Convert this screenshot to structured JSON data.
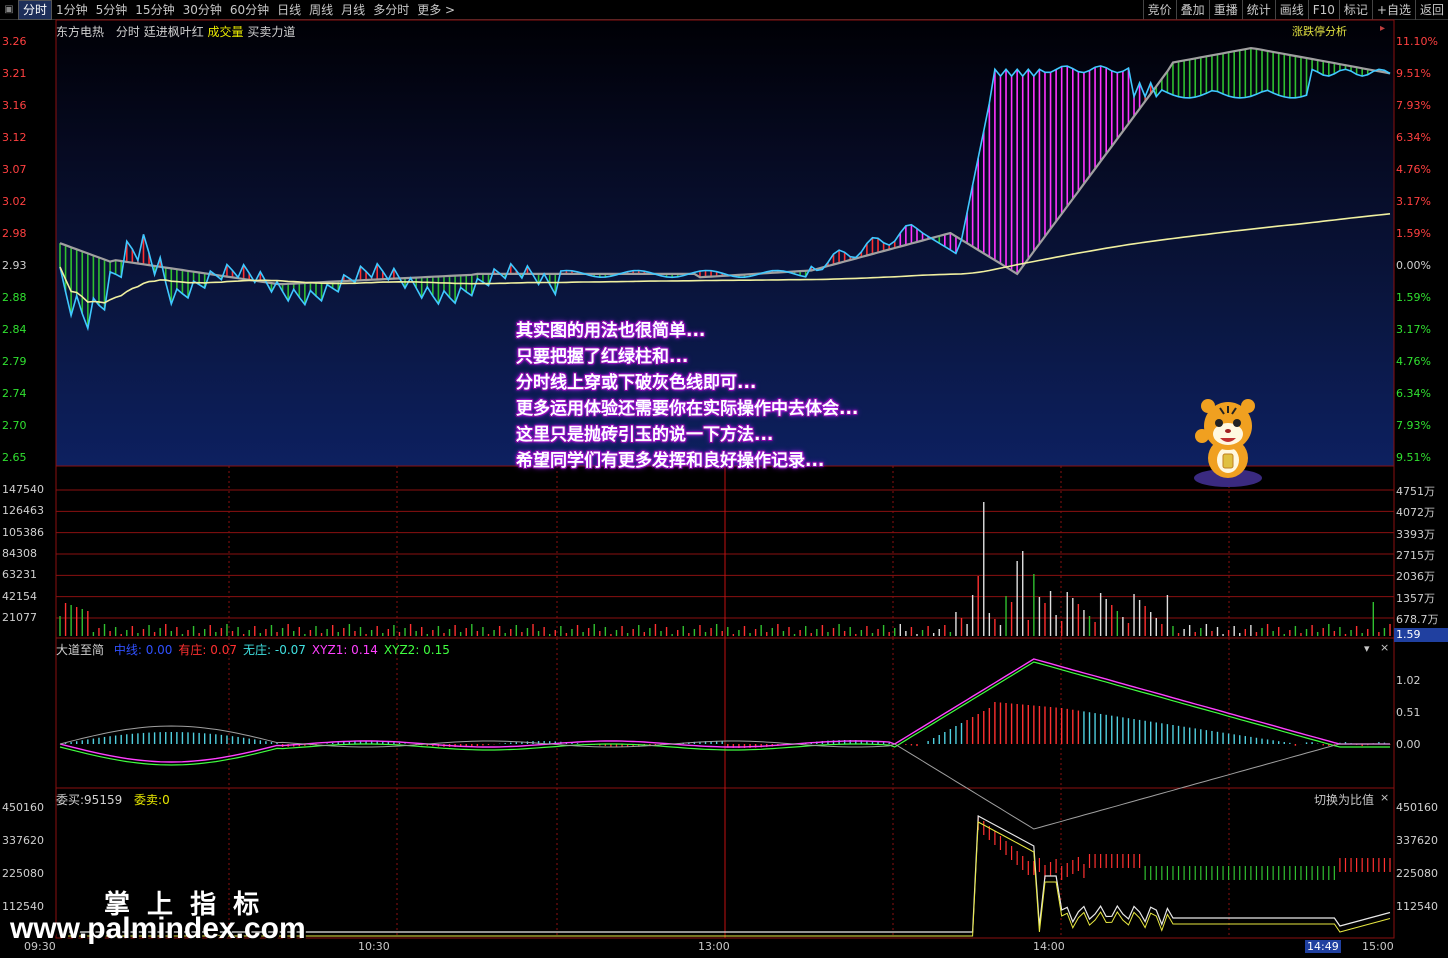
{
  "toolbar": {
    "left_items": [
      {
        "label": "分时",
        "active": true
      },
      {
        "label": "1分钟"
      },
      {
        "label": "5分钟"
      },
      {
        "label": "15分钟"
      },
      {
        "label": "30分钟"
      },
      {
        "label": "60分钟"
      },
      {
        "label": "日线"
      },
      {
        "label": "周线"
      },
      {
        "label": "月线"
      },
      {
        "label": "多分时"
      },
      {
        "label": "更多 >"
      }
    ],
    "right_items": [
      "竞价",
      "叠加",
      "重播",
      "统计",
      "画线",
      "F10",
      "标记",
      "+自选",
      "返回"
    ]
  },
  "price_panel": {
    "stock_name": "东方电热",
    "mode": "分时",
    "indicator_name": "廷进枫叶红",
    "volume_label": "成交量",
    "power_label": "买卖力道",
    "analysis_button": "涨跌停分析",
    "left_axis": [
      "3.26",
      "3.21",
      "3.16",
      "3.12",
      "3.07",
      "3.02",
      "2.98",
      "2.93",
      "2.88",
      "2.84",
      "2.79",
      "2.74",
      "2.70",
      "2.65"
    ],
    "right_axis": [
      "11.10%",
      "9.51%",
      "7.93%",
      "6.34%",
      "4.76%",
      "3.17%",
      "1.59%",
      "0.00%",
      "1.59%",
      "3.17%",
      "4.76%",
      "6.34%",
      "7.93%",
      "9.51%"
    ],
    "overlay_lines": [
      "其实图的用法也很简单...",
      "只要把握了红绿柱和...",
      "分时线上穿或下破灰色线即可...",
      "更多运用体验还需要你在实际操作中去体会...",
      "这里只是抛砖引玉的说一下方法...",
      "希望同学们有更多发挥和良好操作记录..."
    ]
  },
  "volume_panel": {
    "left_axis": [
      "147540",
      "126463",
      "105386",
      "84308",
      "63231",
      "42154",
      "21077"
    ],
    "right_axis": [
      "4751万",
      "4072万",
      "3393万",
      "2715万",
      "2036万",
      "1357万",
      "678.7万"
    ],
    "tag": "1.59"
  },
  "indicator_panel": {
    "name": "大道至简",
    "fields": [
      {
        "label": "中线:",
        "value": "0.00",
        "color": "#3050ff"
      },
      {
        "label": "有庄:",
        "value": "0.07",
        "color": "#ff3030"
      },
      {
        "label": "无庄:",
        "value": "-0.07",
        "color": "#40e0e0"
      },
      {
        "label": "XYZ1:",
        "value": "0.14",
        "color": "#ff40ff"
      },
      {
        "label": "XYZ2:",
        "value": "0.15",
        "color": "#40ff40"
      }
    ],
    "right_axis": [
      "1.02",
      "0.51",
      "0.00"
    ]
  },
  "order_panel": {
    "buy_label": "委买:95159",
    "sell_label": "委卖:0",
    "switch_label": "切换为比值",
    "left_axis": [
      "450160",
      "337620",
      "225080",
      "112540"
    ],
    "right_axis": [
      "450160",
      "337620",
      "225080",
      "112540"
    ]
  },
  "time_axis": [
    "09:30",
    "10:30",
    "13:00",
    "14:00",
    "14:49",
    "15:00"
  ],
  "watermark": {
    "title": "掌 上 指 标",
    "url": "www.palmindex.com"
  },
  "colors": {
    "up": "#ff3030",
    "down": "#30c030",
    "magenta": "#ff33ff",
    "cyan_line": "#40c8ff",
    "avg_line": "#f0f0a0",
    "grey_band": "#a0a0a0",
    "grid": "#8a1010"
  }
}
